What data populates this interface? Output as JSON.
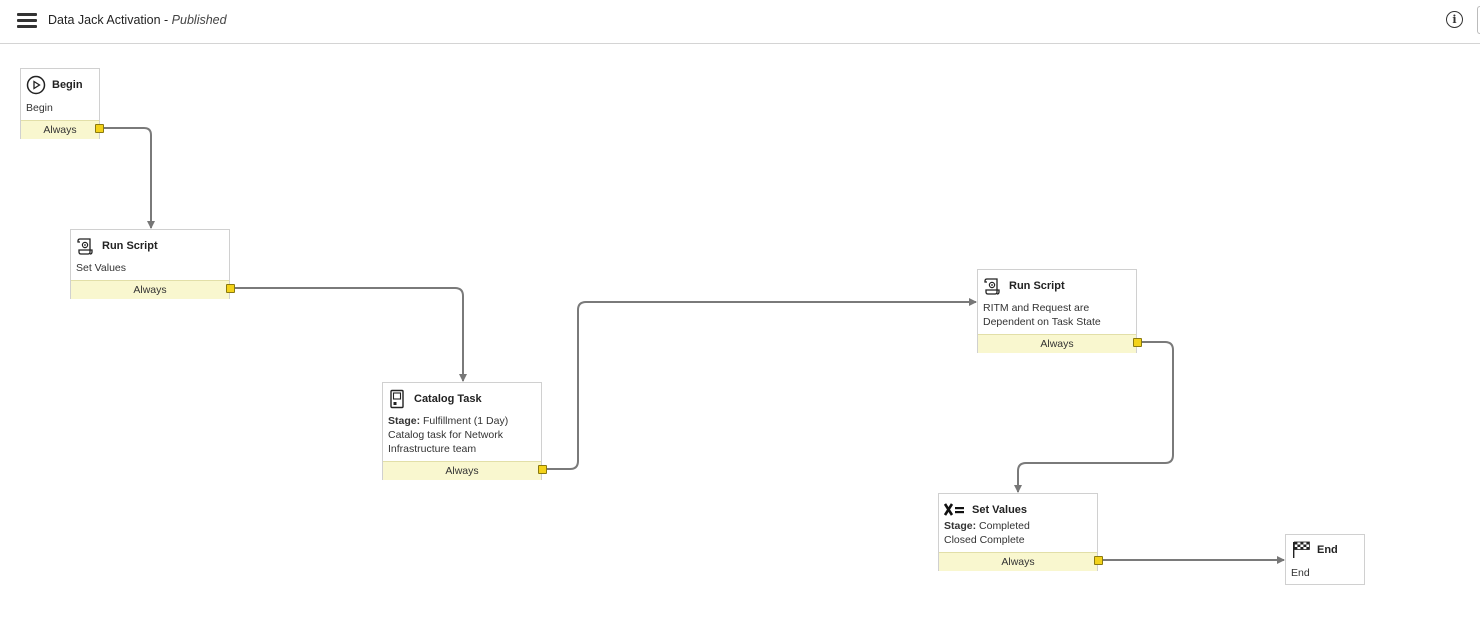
{
  "header": {
    "title": "Data Jack Activation",
    "separator": " - ",
    "status": "Published"
  },
  "nodes": {
    "begin": {
      "title": "Begin",
      "line1": "Begin",
      "condition": "Always"
    },
    "run_script_1": {
      "title": "Run Script",
      "line1": "Set Values",
      "condition": "Always"
    },
    "catalog_task": {
      "title": "Catalog Task",
      "stage_label": "Stage:",
      "stage_value": "Fulfillment (1 Day)",
      "line2": "Catalog task for Network",
      "line3": "Infrastructure team",
      "condition": "Always"
    },
    "run_script_2": {
      "title": "Run Script",
      "line1": "RITM and Request are",
      "line2": "Dependent on Task State",
      "condition": "Always"
    },
    "set_values": {
      "title": "Set Values",
      "stage_label": "Stage:",
      "stage_value": "Completed",
      "line2": "Closed Complete",
      "condition": "Always"
    },
    "end": {
      "title": "End",
      "line1": "End"
    }
  },
  "icons": {
    "menu": "hamburger-menu-icon",
    "info": "info-icon",
    "begin": "play-circle-icon",
    "run_script": "script-scroll-icon",
    "catalog_task": "catalog-task-icon",
    "set_values": "set-values-icon",
    "end": "checkered-flag-icon"
  },
  "colors": {
    "condition_bg": "#f9f7cf",
    "port": "#f3d21a",
    "wire": "#777777"
  }
}
